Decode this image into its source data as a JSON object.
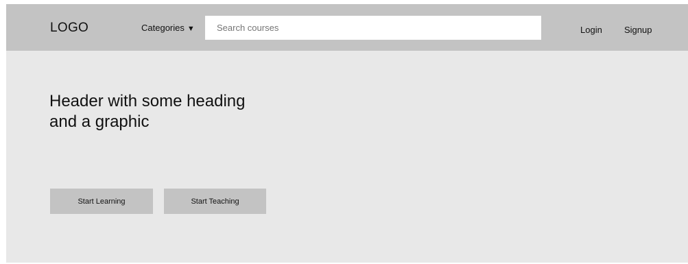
{
  "navbar": {
    "logo": "LOGO",
    "categories_label": "Categories",
    "categories_caret": "▼",
    "search_placeholder": "Search courses",
    "login_label": "Login",
    "signup_label": "Signup"
  },
  "hero": {
    "heading_line1": "Header with some heading",
    "heading_line2": "and a graphic",
    "primary_button": "Start Learning",
    "secondary_button": "Start Teaching"
  },
  "colors": {
    "navbar_bg": "#c3c3c3",
    "page_bg": "#e8e8e8",
    "search_bg": "#ffffff",
    "button_bg": "#c3c3c3",
    "text": "#111111"
  }
}
